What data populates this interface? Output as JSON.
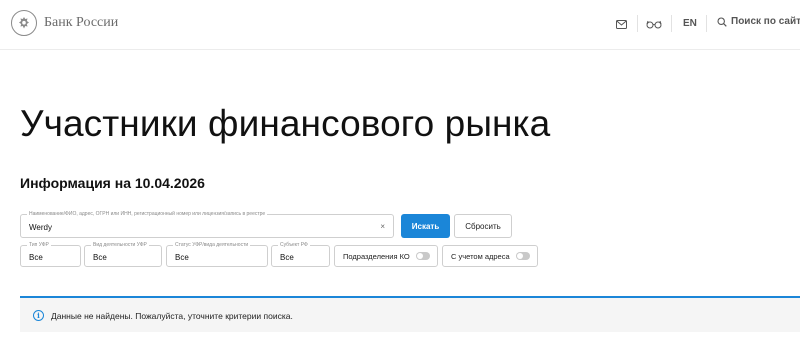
{
  "header": {
    "brand": "Банк России",
    "lang": "EN",
    "search_label": "Поиск по сайту"
  },
  "page": {
    "title": "Участники финансового рынка",
    "info_date": "Информация на 10.04.2026"
  },
  "search": {
    "legend": "Наименование/ФИО, адрес, ОГРН или ИНН, регистрационный номер или лицензия/запись в реестре",
    "value": "Werdy",
    "clear": "×",
    "submit_label": "Искать",
    "reset_label": "Сбросить"
  },
  "filters": [
    {
      "legend": "Тип УФР",
      "value": "Все"
    },
    {
      "legend": "Вид деятельности УФР",
      "value": "Все"
    },
    {
      "legend": "Статус УФР/вида деятельности",
      "value": "Все"
    },
    {
      "legend": "Субъект РФ",
      "value": "Все"
    }
  ],
  "toggles": [
    {
      "label": "Подразделения КО",
      "on": false
    },
    {
      "label": "С учетом адреса",
      "on": false
    }
  ],
  "notice": {
    "icon": "i",
    "text": "Данные не найдены. Пожалуйста, уточните критерии поиска."
  },
  "colors": {
    "accent": "#1b86d8",
    "notice_bg": "#f5f5f5"
  }
}
